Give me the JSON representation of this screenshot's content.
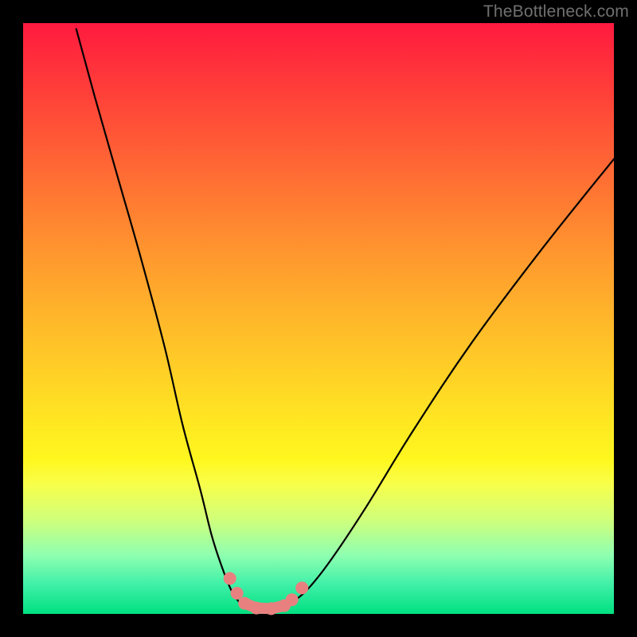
{
  "watermark": "TheBottleneck.com",
  "chart_data": {
    "type": "line",
    "title": "",
    "xlabel": "",
    "ylabel": "",
    "xlim": [
      0,
      100
    ],
    "ylim": [
      0,
      100
    ],
    "series": [
      {
        "name": "left-branch",
        "x": [
          9,
          12,
          16,
          20,
          24,
          27,
          30,
          32,
          34,
          35.5,
          37
        ],
        "values": [
          99,
          88,
          74,
          60,
          45,
          32,
          21,
          13,
          7,
          3.5,
          1.5
        ]
      },
      {
        "name": "valley-floor",
        "x": [
          37,
          39,
          41,
          43,
          45
        ],
        "values": [
          1.5,
          0.9,
          0.8,
          0.9,
          1.6
        ]
      },
      {
        "name": "right-branch",
        "x": [
          45,
          48,
          52,
          58,
          66,
          76,
          88,
          100
        ],
        "values": [
          1.6,
          4,
          9,
          18,
          31,
          46,
          62,
          77
        ]
      }
    ],
    "markers": {
      "name": "highlight-points",
      "x": [
        35,
        36.2,
        37.5,
        39.5,
        42,
        44.2,
        45.5,
        47.2
      ],
      "values": [
        6,
        3.5,
        1.8,
        1.0,
        0.9,
        1.4,
        2.4,
        4.4
      ]
    },
    "colors": {
      "curve": "#000000",
      "markers": "#e98080",
      "gradient_top": "#ff1a3e",
      "gradient_bottom": "#00e080"
    }
  }
}
